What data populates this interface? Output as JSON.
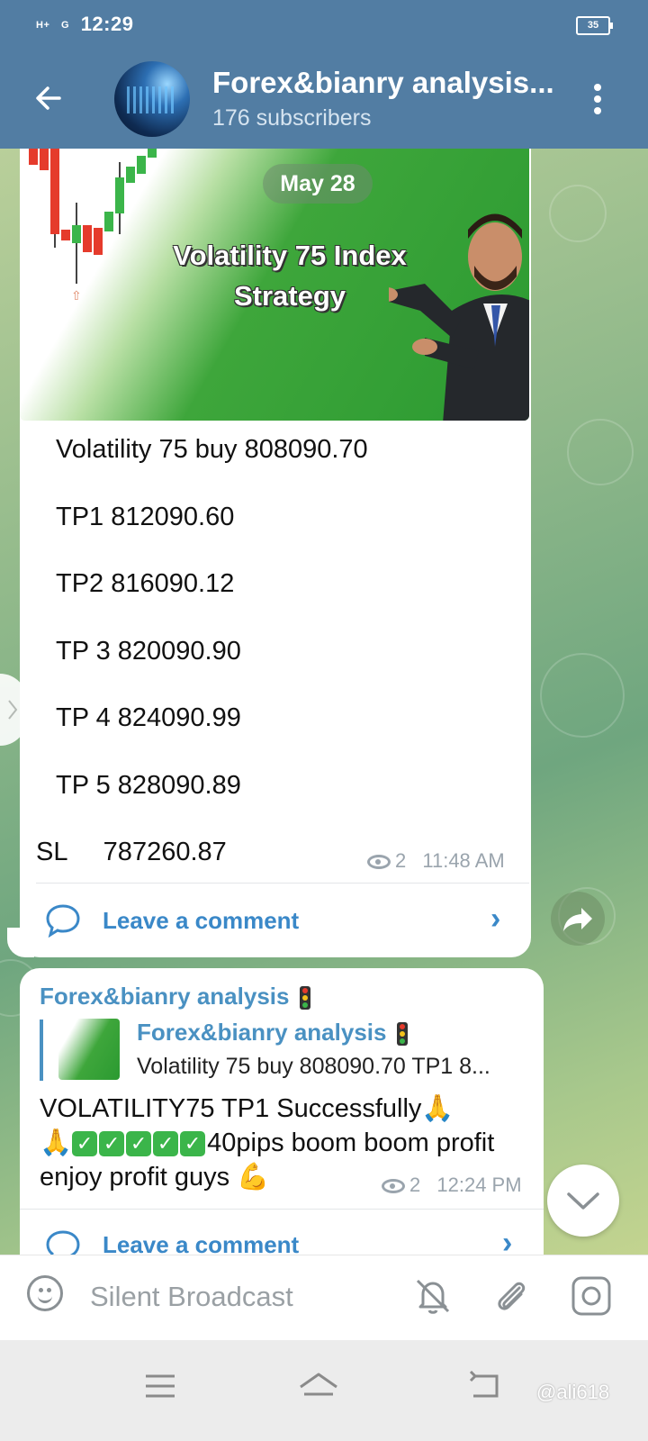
{
  "status_bar": {
    "network_1": "H+",
    "network_2": "G",
    "time": "12:29",
    "battery": "35"
  },
  "header": {
    "title": "Forex&bianry analysis...",
    "subscribers": "176 subscribers"
  },
  "message1": {
    "date_badge": "May 28",
    "promo_title_1": "Volatility 75 Index",
    "promo_title_2": "Strategy",
    "lines": [
      "Volatility 75 buy 808090.70",
      "TP1 812090.60",
      "TP2 816090.12",
      "TP 3 820090.90",
      "TP 4 824090.99",
      "TP 5 828090.89",
      "SL     787260.87"
    ],
    "views": "2",
    "time": "11:48 AM",
    "comment_label": "Leave a comment"
  },
  "message2": {
    "sender": "Forex&bianry analysis",
    "reply_title": "Forex&bianry analysis",
    "reply_text": "Volatility 75 buy 808090.70  TP1 8...",
    "text_part1": "VOLATILITY75 TP1 Successfully🙏",
    "text_part2": "40pips boom boom profit enjoy profit guys 💪",
    "views": "2",
    "time": "12:24 PM",
    "comment_label": "Leave a comment"
  },
  "input_bar": {
    "placeholder": "Silent Broadcast"
  },
  "watermark": "@ali618",
  "colors": {
    "header": "#527da3",
    "link": "#3a88c8",
    "promo_green": "#2b9a31"
  }
}
